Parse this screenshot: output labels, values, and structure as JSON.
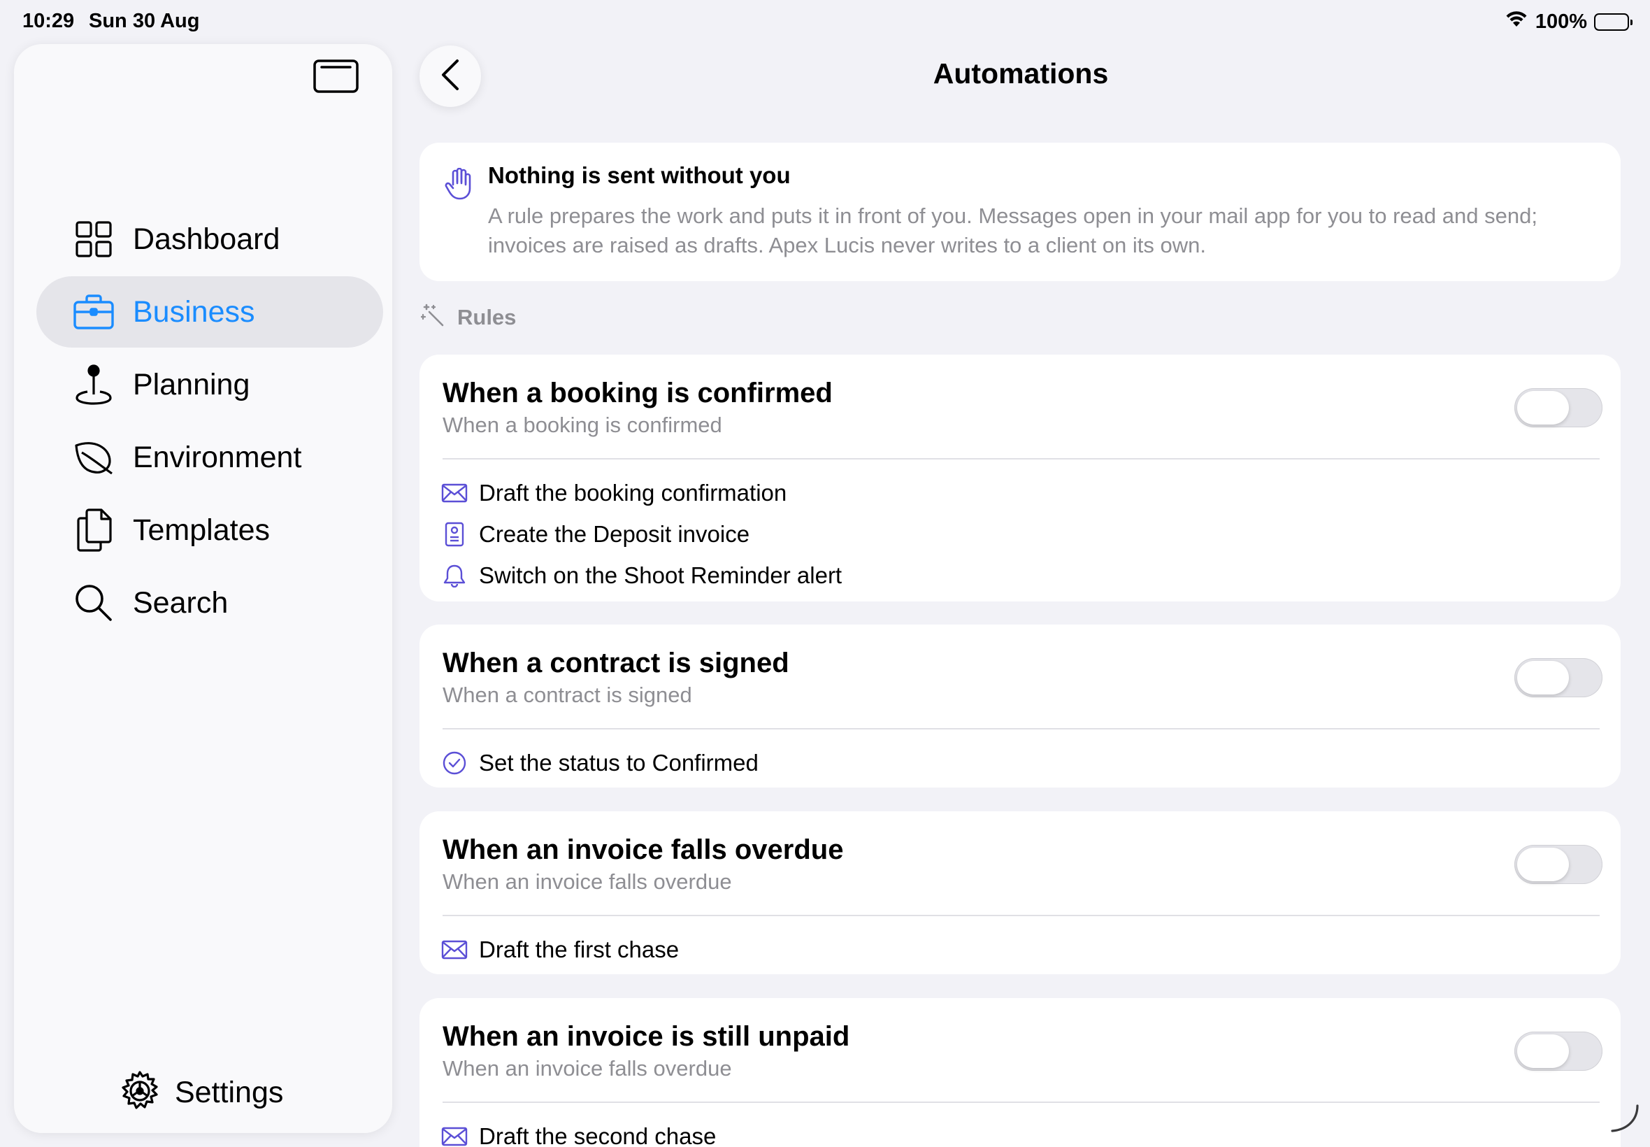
{
  "status_bar": {
    "time": "10:29",
    "date": "Sun 30 Aug",
    "battery": "100%"
  },
  "sidebar": {
    "items": [
      {
        "label": "Dashboard",
        "icon": "grid-icon",
        "active": false
      },
      {
        "label": "Business",
        "icon": "briefcase-icon",
        "active": true
      },
      {
        "label": "Planning",
        "icon": "map-pin-icon",
        "active": false
      },
      {
        "label": "Environment",
        "icon": "leaf-icon",
        "active": false
      },
      {
        "label": "Templates",
        "icon": "documents-icon",
        "active": false
      },
      {
        "label": "Search",
        "icon": "search-icon",
        "active": false
      }
    ],
    "settings_label": "Settings"
  },
  "header": {
    "title": "Automations"
  },
  "notice": {
    "title": "Nothing is sent without you",
    "body": "A rule prepares the work and puts it in front of you. Messages open in your mail app for you to read and send; invoices are raised as drafts. Apex Lucis never writes to a client on its own."
  },
  "section": {
    "label": "Rules"
  },
  "rules": [
    {
      "title": "When a booking is confirmed",
      "subtitle": "When a booking is confirmed",
      "enabled": false,
      "actions": [
        {
          "label": "Draft the booking confirmation",
          "icon": "envelope-icon"
        },
        {
          "label": "Create the Deposit invoice",
          "icon": "invoice-icon"
        },
        {
          "label": "Switch on the Shoot Reminder alert",
          "icon": "bell-icon"
        }
      ]
    },
    {
      "title": "When a contract is signed",
      "subtitle": "When a contract is signed",
      "enabled": false,
      "actions": [
        {
          "label": "Set the status to Confirmed",
          "icon": "checkmark-circle-icon"
        }
      ]
    },
    {
      "title": "When an invoice falls overdue",
      "subtitle": "When an invoice falls overdue",
      "enabled": false,
      "actions": [
        {
          "label": "Draft the first chase",
          "icon": "envelope-icon"
        }
      ]
    },
    {
      "title": "When an invoice is still unpaid",
      "subtitle": "When an invoice falls overdue",
      "enabled": false,
      "actions": [
        {
          "label": "Draft the second chase",
          "icon": "envelope-icon"
        }
      ]
    }
  ],
  "colors": {
    "accent": "#1a8cff",
    "icon_purple": "#5b4fd6",
    "secondary_text": "#8e8e93"
  }
}
